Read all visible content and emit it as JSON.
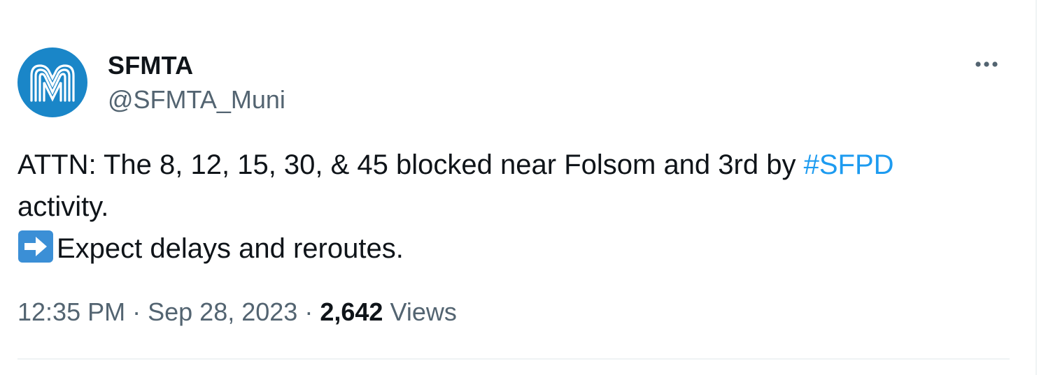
{
  "tweet": {
    "author": {
      "display_name": "SFMTA",
      "handle": "@SFMTA_Muni",
      "avatar_icon": "muni-logo-icon",
      "avatar_color": "#1a86c8"
    },
    "more_icon": "more-horizontal-icon",
    "text": {
      "line1_prefix": "ATTN: The 8, 12, 15, 30, & 45 blocked near Folsom and 3rd by ",
      "hashtag": "#SFPD",
      "line2": "activity.",
      "line3_emoji": "right-arrow-emoji",
      "line3": "Expect delays and reroutes."
    },
    "meta": {
      "time": "12:35 PM",
      "separator": "·",
      "date": "Sep 28, 2023",
      "views_count": "2,642",
      "views_label": "Views"
    },
    "colors": {
      "text": "#0f1419",
      "secondary": "#536471",
      "link": "#1d9bf0",
      "divider": "#eff3f4"
    }
  }
}
